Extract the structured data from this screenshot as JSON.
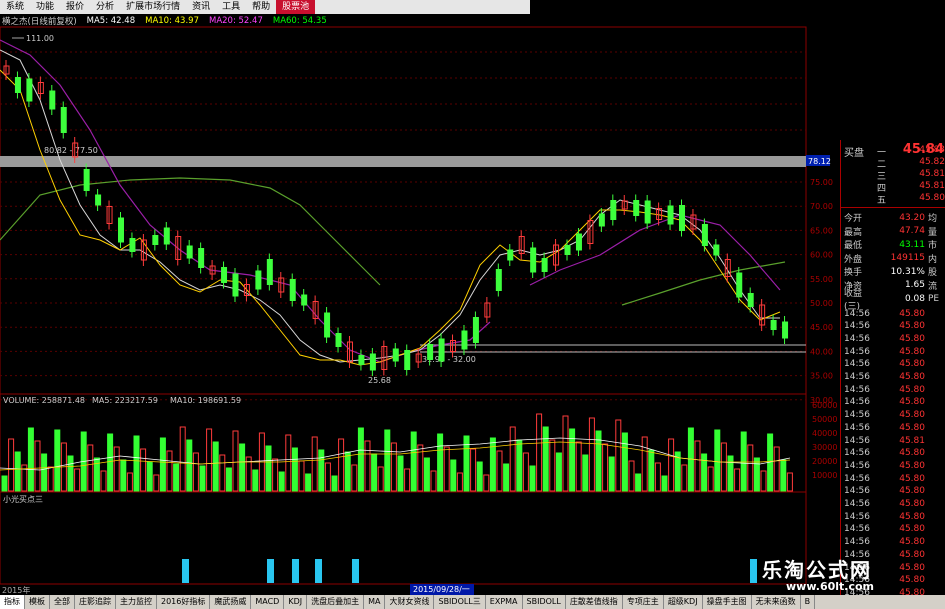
{
  "menu": {
    "items": [
      "系统",
      "功能",
      "报价",
      "分析",
      "扩展市场行情",
      "资讯",
      "工具",
      "帮助"
    ],
    "active_item": "股票池"
  },
  "ma_row": {
    "stock": "横之杰(日线前复权)",
    "ma5": "MA5: 42.48",
    "ma10": "MA10: 43.97",
    "ma20": "MA20: 52.47",
    "ma60": "MA60: 54.35",
    "colors": {
      "stock": "#cccccc",
      "ma5": "#ffffff",
      "ma10": "#ffff00",
      "ma20": "#ff44ff",
      "ma60": "#00ff00"
    }
  },
  "price_chart": {
    "high_label": "111.00",
    "range_label": "80.82 - 77.50",
    "highlight_value": "78.12",
    "low_label": "25.68",
    "low_range_label": "31.95 - 32.00",
    "axis_labels": [
      "75.00",
      "70.00",
      "65.00",
      "60.00",
      "55.00",
      "50.00",
      "45.00",
      "40.00",
      "35.00",
      "30.00"
    ]
  },
  "volume_chart": {
    "title": "VOLUME: 258871.48",
    "ma5": "MA5: 223217.59",
    "ma10": "MA10: 198691.59",
    "axis_labels": [
      "60000",
      "50000",
      "40000",
      "30000",
      "20000",
      "10000"
    ]
  },
  "indicator": {
    "title": "小光买点三"
  },
  "quote_panel": {
    "title": "买盘",
    "price": "45.84",
    "bid_levels": [
      {
        "label": "一",
        "price": "45.83"
      },
      {
        "label": "二",
        "price": "45.82"
      },
      {
        "label": "三",
        "price": "45.81"
      },
      {
        "label": "四",
        "price": "45.81"
      },
      {
        "label": "五",
        "price": "45.80"
      }
    ],
    "stats": [
      {
        "label": "今开",
        "value": "43.20",
        "extra": "均",
        "color": "#ff3333"
      },
      {
        "label": "最高",
        "value": "47.74",
        "extra": "量",
        "color": "#ff3333"
      },
      {
        "label": "最低",
        "value": "43.11",
        "extra": "市",
        "color": "#00ff00"
      },
      {
        "label": "外盘",
        "value": "149115",
        "extra": "内",
        "color": "#ff3333"
      },
      {
        "label": "换手",
        "value": "10.31%",
        "extra": "股",
        "color": "#ffffff"
      },
      {
        "label": "净资",
        "value": "1.65",
        "extra": "流",
        "color": "#ffffff"
      },
      {
        "label": "收益(三)",
        "value": "0.08",
        "extra": "PE",
        "color": "#ffffff"
      }
    ],
    "ticks": [
      {
        "time": "14:56",
        "price": "45.80"
      },
      {
        "time": "14:56",
        "price": "45.80"
      },
      {
        "time": "14:56",
        "price": "45.80"
      },
      {
        "time": "14:56",
        "price": "45.80"
      },
      {
        "time": "14:56",
        "price": "45.80"
      },
      {
        "time": "14:56",
        "price": "45.80"
      },
      {
        "time": "14:56",
        "price": "45.80"
      },
      {
        "time": "14:56",
        "price": "45.80"
      },
      {
        "time": "14:56",
        "price": "45.80"
      },
      {
        "time": "14:56",
        "price": "45.80"
      },
      {
        "time": "14:56",
        "price": "45.81"
      },
      {
        "time": "14:56",
        "price": "45.80"
      },
      {
        "time": "14:56",
        "price": "45.80"
      },
      {
        "time": "14:56",
        "price": "45.80"
      },
      {
        "time": "14:56",
        "price": "45.80"
      },
      {
        "time": "14:56",
        "price": "45.80"
      },
      {
        "time": "14:56",
        "price": "45.80"
      },
      {
        "time": "14:56",
        "price": "45.80"
      },
      {
        "time": "14:56",
        "price": "45.80"
      },
      {
        "time": "14:56",
        "price": "45.80"
      },
      {
        "time": "14:56",
        "price": "45.80"
      },
      {
        "time": "14:56",
        "price": "45.80"
      },
      {
        "time": "14:56",
        "price": "45.80"
      }
    ]
  },
  "bottom": {
    "year": "2015年",
    "date": "2015/09/28/一",
    "tabs": [
      "指标",
      "模板",
      "全部",
      "庄影追踪",
      "主力监控",
      "2016好指标",
      "魔武扬威",
      "MACD",
      "KDJ",
      "洗盘后叠加主",
      "MA",
      "大财女资线",
      "SBIDOLL三",
      "EXPMA",
      "SBIDOLL",
      "庄散差值线指",
      "专项庄主",
      "超级KDJ",
      "操盘手主图",
      "无未来函数",
      "B"
    ],
    "active_tab": "指标"
  },
  "watermark": {
    "title": "乐淘公式网",
    "url": "www.60lt.com"
  }
}
